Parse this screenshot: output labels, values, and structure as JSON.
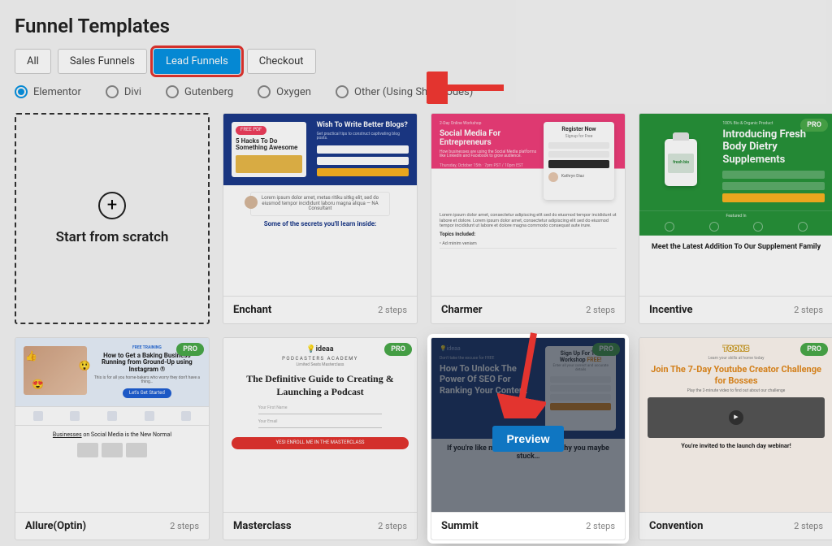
{
  "title": "Funnel Templates",
  "tabs": [
    {
      "label": "All",
      "active": false
    },
    {
      "label": "Sales Funnels",
      "active": false
    },
    {
      "label": "Lead Funnels",
      "active": true
    },
    {
      "label": "Checkout",
      "active": false
    }
  ],
  "builders": [
    {
      "label": "Elementor",
      "selected": true
    },
    {
      "label": "Divi",
      "selected": false
    },
    {
      "label": "Gutenberg",
      "selected": false
    },
    {
      "label": "Oxygen",
      "selected": false
    },
    {
      "label": "Other (Using Shortcodes)",
      "selected": false
    }
  ],
  "scratch": {
    "label": "Start from scratch"
  },
  "preview_button": "Preview",
  "badges": {
    "pro": "PRO"
  },
  "cards": {
    "enchant": {
      "name": "Enchant",
      "steps": "2 steps",
      "pdf_tag": "FREE PDF",
      "hack_title": "5 Hacks To Do Something Awesome",
      "title": "Wish To Write Better Blogs?",
      "subtitle": "Get practical tips to construct captivating blog posts.",
      "secrets": "Some of the secrets you'll learn inside:"
    },
    "charmer": {
      "name": "Charmer",
      "steps": "2 steps",
      "category": "2-Day Online Workshop",
      "title": "Social Media For Entrepreneurs",
      "desc": "How businesses are using the Social Media platforms like LinkedIn and Facebook to grow audience.",
      "register": "Register Now",
      "register_sub": "Signup for Free",
      "btn": "Sign me up",
      "person": "Kathryn Diaz",
      "topics": "Topics Included:"
    },
    "incentive": {
      "name": "Incentive",
      "steps": "2 steps",
      "small": "100% Bio & Organic Product",
      "title1": "Introducing",
      "title2": "Fresh Body",
      "title3": "Dietry",
      "title4": "Supplements",
      "bottle_label": "fresh bio",
      "featured": "Featured In",
      "bottom": "Meet the Latest Addition To Our Supplement Family"
    },
    "allure": {
      "name": "Allure(Optin)",
      "steps": "2 steps",
      "tag": "FREE TRAINING",
      "title": "How to Get a Baking Business Running from Ground-Up using Instagram ®",
      "desc": "This is for all you home-bakers who worry they don't have a thing…",
      "btn": "Let's Get Started",
      "sec2_pre": "Businesses",
      "sec2_rest": " on Social Media is the New Normal"
    },
    "masterclass": {
      "name": "Masterclass",
      "steps": "2 steps",
      "logo": "ideaa",
      "cat": "PODCASTERS ACADEMY",
      "seats": "Limited Seats Masterclass",
      "title": "The Definitive Guide to Creating & Launching a Podcast",
      "field1": "Your First Name",
      "field2": "Your Email",
      "btn": "YES! ENROLL ME IN THE MASTERCLASS"
    },
    "summit": {
      "name": "Summit",
      "steps": "2 steps",
      "logo": "ideaa",
      "tag": "Don't take the excuse for FREE",
      "title": "How To Unlock The Power Of SEO For Ranking Your Content",
      "sign": "Sign Up For The Workshop ",
      "free": "FREE!",
      "sub": "Enter all your correct and accurate details",
      "btn": "SIGN UP NOW",
      "bottom": "If you're like most creators, here's why you maybe stuck…"
    },
    "convention": {
      "name": "Convention",
      "steps": "2 steps",
      "logo": "TOONS",
      "sub": "Learn your skills at home today",
      "title": "Join The 7-Day Youtube Creator Challenge for Bosses",
      "desc": "Play the 2-minute video to find out about our challenge",
      "invite": "You're invited to the launch day webinar!"
    }
  }
}
